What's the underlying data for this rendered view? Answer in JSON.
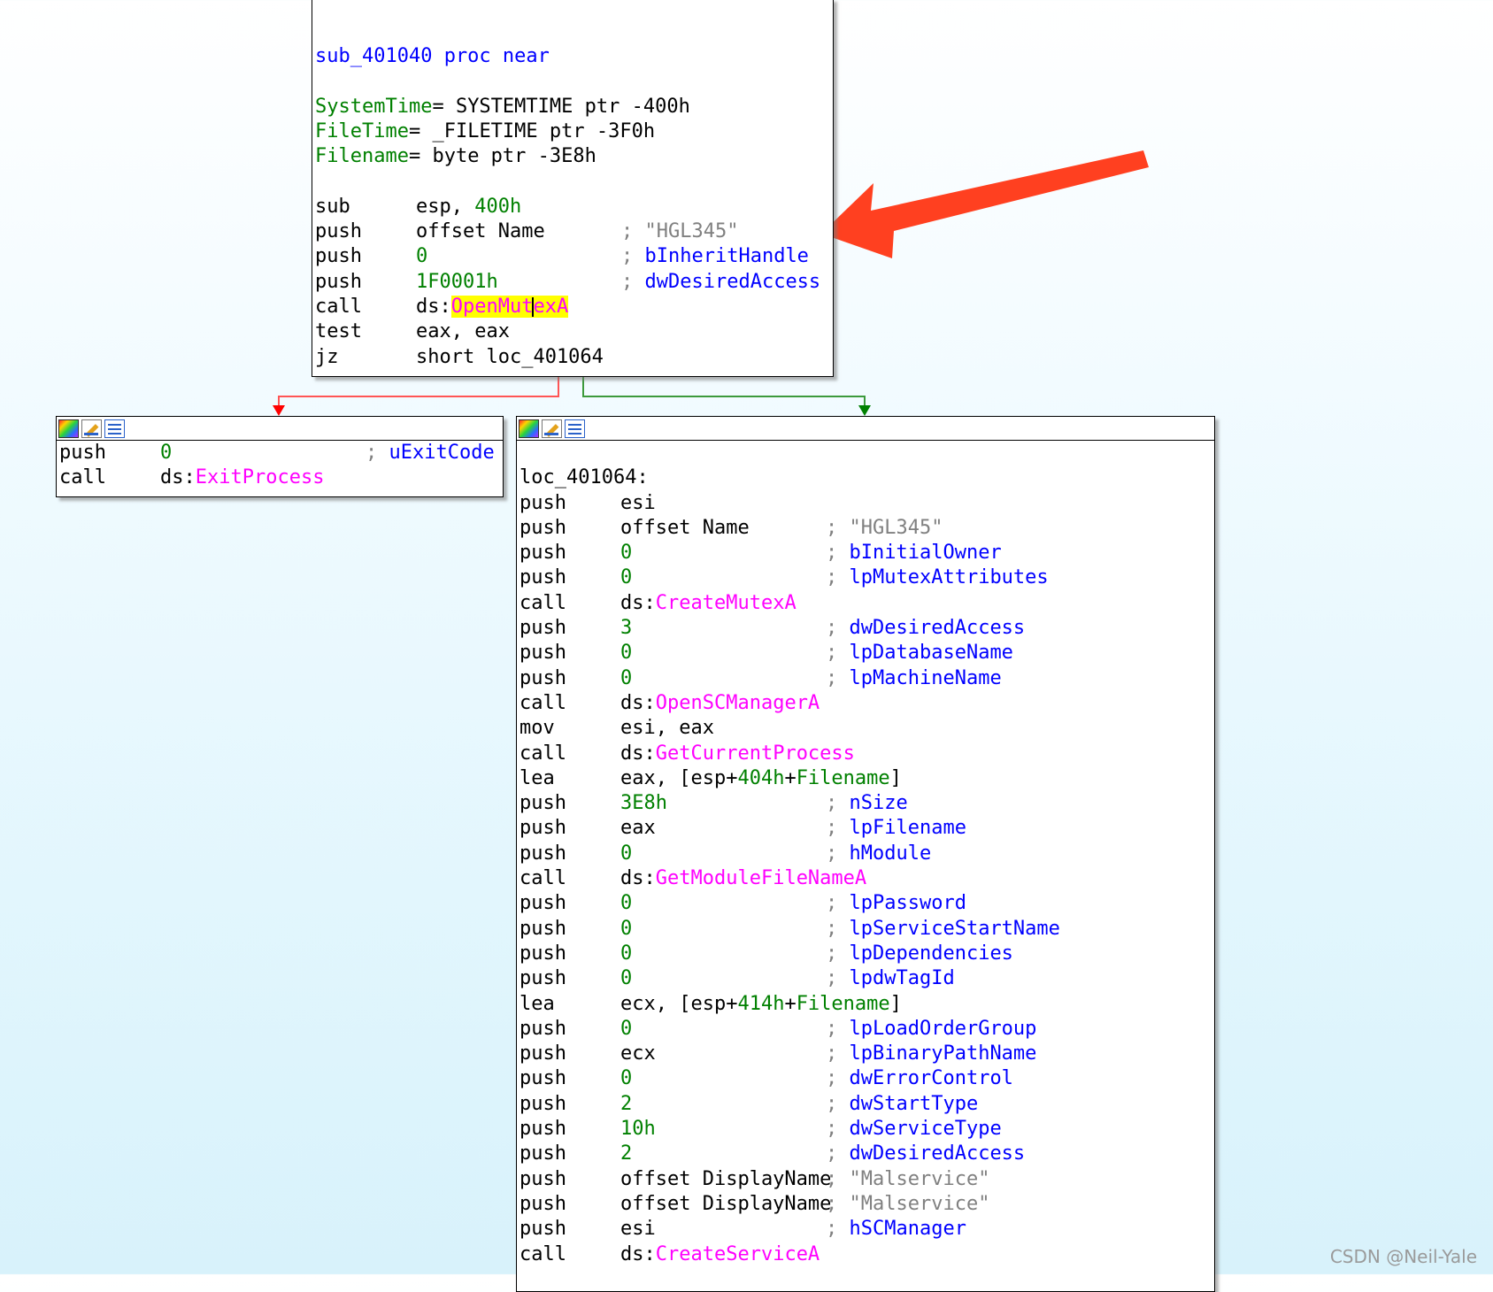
{
  "colors": {
    "mnemonic": "#000000",
    "number": "#008000",
    "api": "#ff00ff",
    "label": "#0000ff",
    "comment": "#0000ff",
    "string": "#808080",
    "highlight": "#ffff00",
    "edge_false": "#ff0000",
    "edge_true": "#008000",
    "arrow": "#ff4020"
  },
  "top_block": {
    "header": [
      {
        "text": "sub_401040 proc near",
        "cls": "k-kw"
      }
    ],
    "vars": [
      {
        "name": "SystemTime",
        "def": "= SYSTEMTIME ptr -400h"
      },
      {
        "name": "FileTime",
        "def": "= _FILETIME ptr -3F0h"
      },
      {
        "name": "Filename",
        "def": "= byte ptr -3E8h"
      }
    ],
    "lines": [
      {
        "mn": "sub",
        "op": [
          {
            "t": "esp, ",
            "c": "k-name"
          },
          {
            "t": "400h",
            "c": "k-num"
          }
        ],
        "cm": ""
      },
      {
        "mn": "push",
        "op": [
          {
            "t": "offset Name",
            "c": "k-name"
          }
        ],
        "cm": "\"HGL345\"",
        "cmc": "k-str"
      },
      {
        "mn": "push",
        "op": [
          {
            "t": "0",
            "c": "k-num"
          }
        ],
        "cm": "bInheritHandle"
      },
      {
        "mn": "push",
        "op": [
          {
            "t": "1F0001h",
            "c": "k-num"
          }
        ],
        "cm": "dwDesiredAccess"
      },
      {
        "mn": "call",
        "op": [
          {
            "t": "ds",
            "c": "k-name"
          },
          {
            "t": ":",
            "c": "k-name"
          },
          {
            "t": "OpenMutexA",
            "c": "k-hl"
          }
        ],
        "cm": ""
      },
      {
        "mn": "test",
        "op": [
          {
            "t": "eax, eax",
            "c": "k-name"
          }
        ],
        "cm": ""
      },
      {
        "mn": "jz",
        "op": [
          {
            "t": "short loc_401064",
            "c": "k-name"
          }
        ],
        "cm": ""
      }
    ]
  },
  "left_block": {
    "lines": [
      {
        "mn": "push",
        "op": [
          {
            "t": "0",
            "c": "k-num"
          }
        ],
        "cm": "uExitCode"
      },
      {
        "mn": "call",
        "op": [
          {
            "t": "ds",
            "c": "k-name"
          },
          {
            "t": ":",
            "c": "k-name"
          },
          {
            "t": "ExitProcess",
            "c": "k-api"
          }
        ],
        "cm": ""
      }
    ]
  },
  "right_block": {
    "label": "loc_401064:",
    "lines": [
      {
        "mn": "push",
        "op": [
          {
            "t": "esi",
            "c": "k-name"
          }
        ],
        "cm": ""
      },
      {
        "mn": "push",
        "op": [
          {
            "t": "offset Name",
            "c": "k-name"
          }
        ],
        "cm": "\"HGL345\"",
        "cmc": "k-str"
      },
      {
        "mn": "push",
        "op": [
          {
            "t": "0",
            "c": "k-num"
          }
        ],
        "cm": "bInitialOwner"
      },
      {
        "mn": "push",
        "op": [
          {
            "t": "0",
            "c": "k-num"
          }
        ],
        "cm": "lpMutexAttributes"
      },
      {
        "mn": "call",
        "op": [
          {
            "t": "ds",
            "c": "k-name"
          },
          {
            "t": ":",
            "c": "k-name"
          },
          {
            "t": "CreateMutexA",
            "c": "k-api"
          }
        ],
        "cm": ""
      },
      {
        "mn": "push",
        "op": [
          {
            "t": "3",
            "c": "k-num"
          }
        ],
        "cm": "dwDesiredAccess"
      },
      {
        "mn": "push",
        "op": [
          {
            "t": "0",
            "c": "k-num"
          }
        ],
        "cm": "lpDatabaseName"
      },
      {
        "mn": "push",
        "op": [
          {
            "t": "0",
            "c": "k-num"
          }
        ],
        "cm": "lpMachineName"
      },
      {
        "mn": "call",
        "op": [
          {
            "t": "ds",
            "c": "k-name"
          },
          {
            "t": ":",
            "c": "k-name"
          },
          {
            "t": "OpenSCManagerA",
            "c": "k-api"
          }
        ],
        "cm": ""
      },
      {
        "mn": "mov",
        "op": [
          {
            "t": "esi, eax",
            "c": "k-name"
          }
        ],
        "cm": ""
      },
      {
        "mn": "call",
        "op": [
          {
            "t": "ds",
            "c": "k-name"
          },
          {
            "t": ":",
            "c": "k-name"
          },
          {
            "t": "GetCurrentProcess",
            "c": "k-api"
          }
        ],
        "cm": ""
      },
      {
        "mn": "lea",
        "op": [
          {
            "t": "eax, [esp+",
            "c": "k-name"
          },
          {
            "t": "404h",
            "c": "k-num"
          },
          {
            "t": "+",
            "c": "k-name"
          },
          {
            "t": "Filename",
            "c": "k-var"
          },
          {
            "t": "]",
            "c": "k-name"
          }
        ],
        "cm": ""
      },
      {
        "mn": "push",
        "op": [
          {
            "t": "3E8h",
            "c": "k-num"
          }
        ],
        "cm": "nSize"
      },
      {
        "mn": "push",
        "op": [
          {
            "t": "eax",
            "c": "k-name"
          }
        ],
        "cm": "lpFilename"
      },
      {
        "mn": "push",
        "op": [
          {
            "t": "0",
            "c": "k-num"
          }
        ],
        "cm": "hModule"
      },
      {
        "mn": "call",
        "op": [
          {
            "t": "ds",
            "c": "k-name"
          },
          {
            "t": ":",
            "c": "k-name"
          },
          {
            "t": "GetModuleFileNameA",
            "c": "k-api"
          }
        ],
        "cm": ""
      },
      {
        "mn": "push",
        "op": [
          {
            "t": "0",
            "c": "k-num"
          }
        ],
        "cm": "lpPassword"
      },
      {
        "mn": "push",
        "op": [
          {
            "t": "0",
            "c": "k-num"
          }
        ],
        "cm": "lpServiceStartName"
      },
      {
        "mn": "push",
        "op": [
          {
            "t": "0",
            "c": "k-num"
          }
        ],
        "cm": "lpDependencies"
      },
      {
        "mn": "push",
        "op": [
          {
            "t": "0",
            "c": "k-num"
          }
        ],
        "cm": "lpdwTagId"
      },
      {
        "mn": "lea",
        "op": [
          {
            "t": "ecx, [esp+",
            "c": "k-name"
          },
          {
            "t": "414h",
            "c": "k-num"
          },
          {
            "t": "+",
            "c": "k-name"
          },
          {
            "t": "Filename",
            "c": "k-var"
          },
          {
            "t": "]",
            "c": "k-name"
          }
        ],
        "cm": ""
      },
      {
        "mn": "push",
        "op": [
          {
            "t": "0",
            "c": "k-num"
          }
        ],
        "cm": "lpLoadOrderGroup"
      },
      {
        "mn": "push",
        "op": [
          {
            "t": "ecx",
            "c": "k-name"
          }
        ],
        "cm": "lpBinaryPathName"
      },
      {
        "mn": "push",
        "op": [
          {
            "t": "0",
            "c": "k-num"
          }
        ],
        "cm": "dwErrorControl"
      },
      {
        "mn": "push",
        "op": [
          {
            "t": "2",
            "c": "k-num"
          }
        ],
        "cm": "dwStartType"
      },
      {
        "mn": "push",
        "op": [
          {
            "t": "10h",
            "c": "k-num"
          }
        ],
        "cm": "dwServiceType"
      },
      {
        "mn": "push",
        "op": [
          {
            "t": "2",
            "c": "k-num"
          }
        ],
        "cm": "dwDesiredAccess"
      },
      {
        "mn": "push",
        "op": [
          {
            "t": "offset DisplayName",
            "c": "k-name"
          }
        ],
        "cm": "\"Malservice\"",
        "cmc": "k-str"
      },
      {
        "mn": "push",
        "op": [
          {
            "t": "offset DisplayName",
            "c": "k-name"
          }
        ],
        "cm": "\"Malservice\"",
        "cmc": "k-str"
      },
      {
        "mn": "push",
        "op": [
          {
            "t": "esi",
            "c": "k-name"
          }
        ],
        "cm": "hSCManager"
      },
      {
        "mn": "call",
        "op": [
          {
            "t": "ds",
            "c": "k-name"
          },
          {
            "t": ":",
            "c": "k-name"
          },
          {
            "t": "CreateServiceA",
            "c": "k-api"
          }
        ],
        "cm": ""
      }
    ]
  },
  "icons": [
    "graph-overview-icon",
    "edit-icon",
    "text-view-icon"
  ],
  "watermark": "CSDN @Neil-Yale"
}
